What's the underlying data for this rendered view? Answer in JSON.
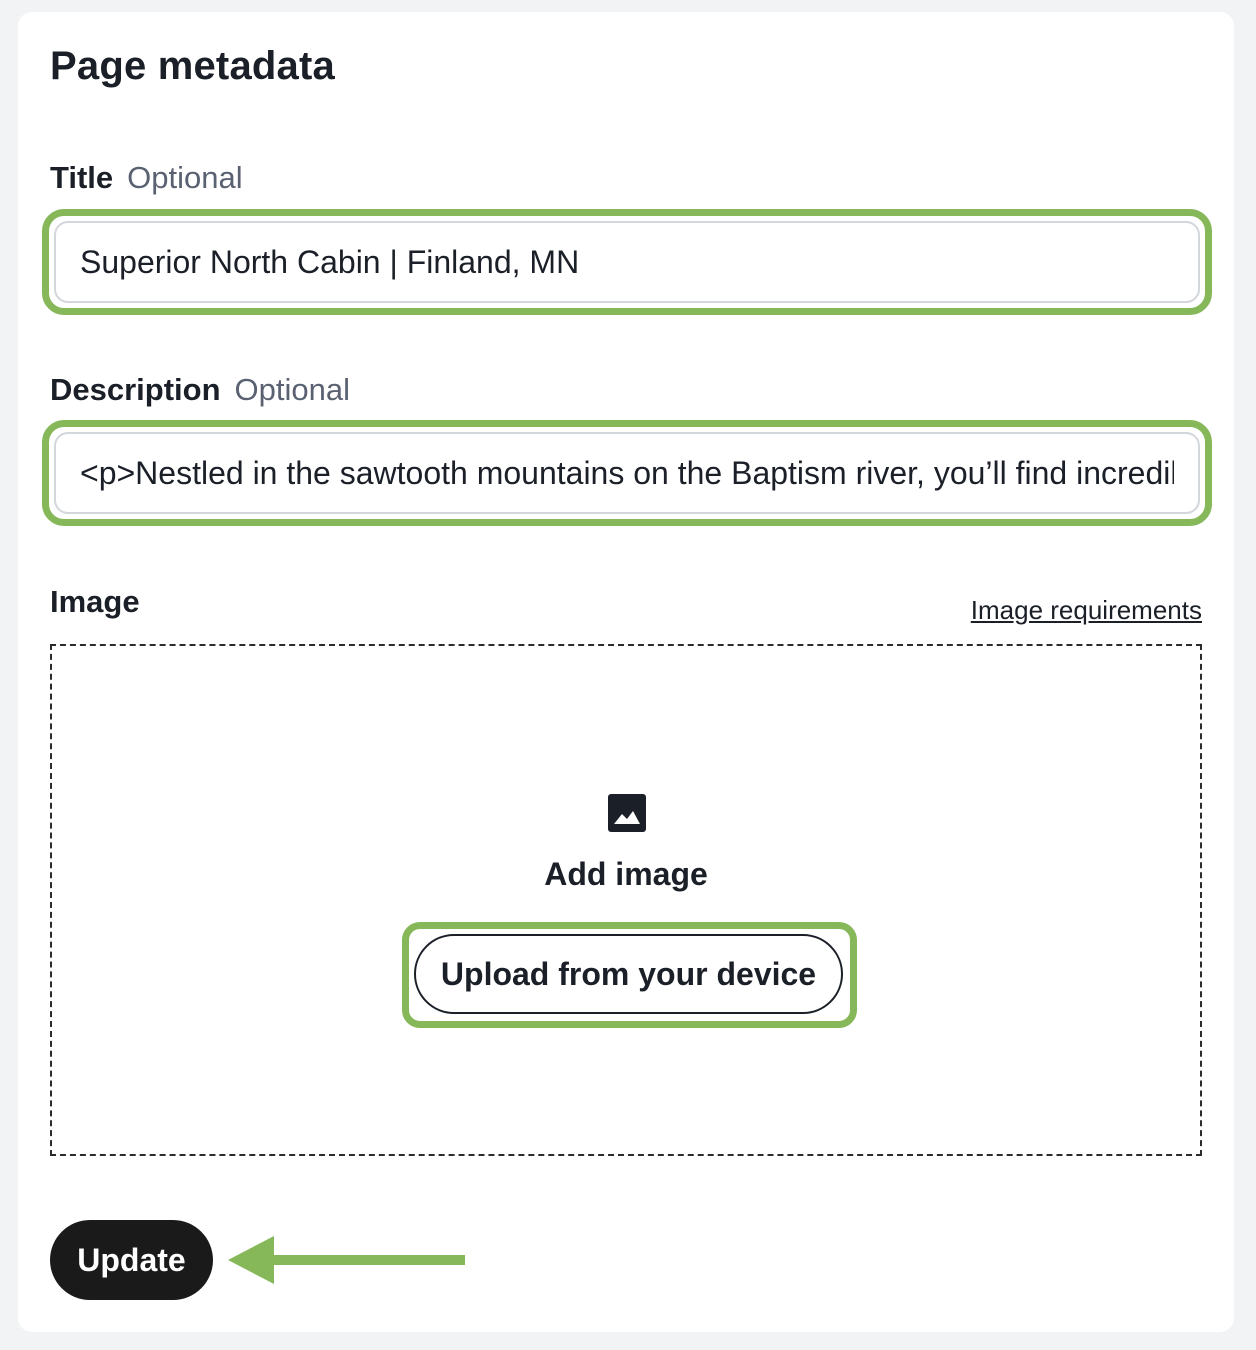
{
  "page": {
    "heading": "Page metadata"
  },
  "title_field": {
    "label": "Title",
    "optional": "Optional",
    "value": "Superior North Cabin | Finland, MN"
  },
  "description_field": {
    "label": "Description",
    "optional": "Optional",
    "value": "<p>Nestled in the sawtooth mountains on the Baptism river, you’ll find incredible"
  },
  "image_section": {
    "label": "Image",
    "requirements_link": "Image requirements",
    "dropzone_icon": "image-icon",
    "dropzone_text": "Add image",
    "upload_button": "Upload from your device"
  },
  "actions": {
    "update_button": "Update"
  },
  "colors": {
    "highlight": "#86b85a",
    "primary_button": "#1a1a1a",
    "annotation_arrow": "#86b85a"
  }
}
